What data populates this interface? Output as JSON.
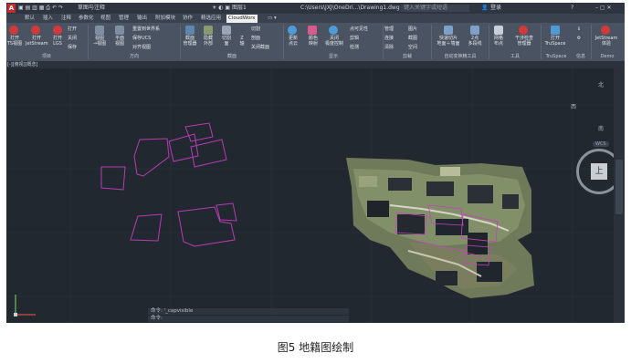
{
  "titlebar": {
    "logo": "A",
    "quick_access": [
      "新建",
      "打开",
      "保存",
      "另存",
      "打印",
      "撤销",
      "重做",
      "草图与注释"
    ],
    "layer": "图层1",
    "document_path": "C:\\Users\\JXJ\\OneDri...\\Drawing1.dwg",
    "search_placeholder": "键入关键字或短语",
    "login": "登录",
    "help": "?"
  },
  "tabs": [
    "默认",
    "插入",
    "注释",
    "参数化",
    "视图",
    "管理",
    "输出",
    "附加模块",
    "协作",
    "精选应用",
    "CloudWorx"
  ],
  "active_tab": "CloudWorx",
  "ribbon": {
    "groups": [
      {
        "label": "项目",
        "buttons": [
          "打开\nTS视图",
          "打开\nJetStream",
          "打开\nLGS",
          "打开",
          "关闭",
          "保存"
        ]
      },
      {
        "label": "方向",
        "buttons": [
          "视图\n→视图",
          "平面\n视图",
          "重置到世界系",
          "保存UCS",
          "对齐视图"
        ]
      },
      {
        "label": "截面",
        "buttons": [
          "截面\n管理器",
          "隐藏\n外部",
          "切割\n面",
          "Z\n轴",
          "切割",
          "剖面",
          "关闭截面"
        ]
      },
      {
        "label": "显示",
        "buttons": [
          "更新\n点云",
          "颜色\n映射",
          "关闭\n极度控制",
          "点可见性",
          "剪辑",
          "检测"
        ]
      },
      {
        "label": "剪裁",
        "buttons": [
          "管理",
          "连接",
          "清除",
          "图片",
          "截图",
          "空间"
        ]
      },
      {
        "label": "自动变换精工具",
        "buttons": [
          "快速切片\n地面＋墙面",
          "2点\n多段线"
        ]
      },
      {
        "label": "工具",
        "buttons": [
          "网格\n布点",
          "干涉检查\n管理器"
        ]
      },
      {
        "label": "TruSpace",
        "buttons": [
          "打开\nTruSpace"
        ]
      },
      {
        "label": "信息",
        "buttons": []
      },
      {
        "label": "Demo",
        "buttons": [
          "JetStream\n体验"
        ]
      }
    ]
  },
  "viewport_label": "[-][俯视][概念]",
  "viewcube": {
    "top": "上",
    "north": "北",
    "south": "南",
    "east": "东",
    "west": "西",
    "wcs": "WCS"
  },
  "command_line": [
    "命令: '_capvisible",
    "命令:"
  ],
  "caption": "图5   地籍图绘制",
  "colors": {
    "canvas": "#212830",
    "ribbon": "#4a5361",
    "parcel": "#b83bb4",
    "pointcloud": "#8a9a70"
  }
}
